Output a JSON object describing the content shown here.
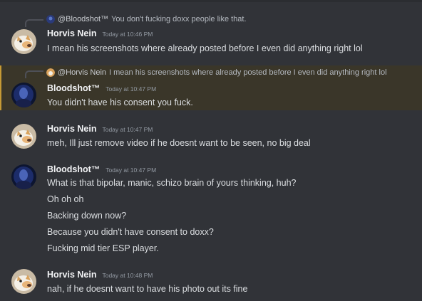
{
  "messages": [
    {
      "reply": {
        "author": "@Bloodshot™",
        "text": "You don't fucking doxx people like that."
      },
      "author": "Horvis Nein",
      "time": "Today at 10:46 PM",
      "lines": [
        "I mean his screenshots where already posted before I even did anything right lol"
      ]
    },
    {
      "reply": {
        "author": "@Horvis Nein",
        "text": "I mean his screenshots where already posted before I even did anything right lol"
      },
      "author": "Bloodshot™",
      "time": "Today at 10:47 PM",
      "lines": [
        "You didn't have his consent you fuck."
      ]
    },
    {
      "author": "Horvis Nein",
      "time": "Today at 10:47 PM",
      "lines": [
        "meh, Ill just remove video if he doesnt want to be seen, no big deal"
      ]
    },
    {
      "author": "Bloodshot™",
      "time": "Today at 10:47 PM",
      "lines": [
        "What is that bipolar, manic, schizo brain of yours thinking, huh?",
        "Oh oh oh",
        "Backing down now?",
        "Because you didn't have consent to doxx?",
        "Fucking mid tier ESP player."
      ]
    },
    {
      "author": "Horvis Nein",
      "time": "Today at 10:48 PM",
      "lines": [
        "nah, if he doesnt want to have his photo out its fine"
      ]
    }
  ],
  "colors": {
    "background": "#313338",
    "mention_highlight": "#3a3629",
    "mention_bar": "#c69a35"
  },
  "icons": {
    "horvis_avatar": "fox-avatar-icon",
    "bloodshot_avatar": "dark-portrait-avatar-icon"
  }
}
